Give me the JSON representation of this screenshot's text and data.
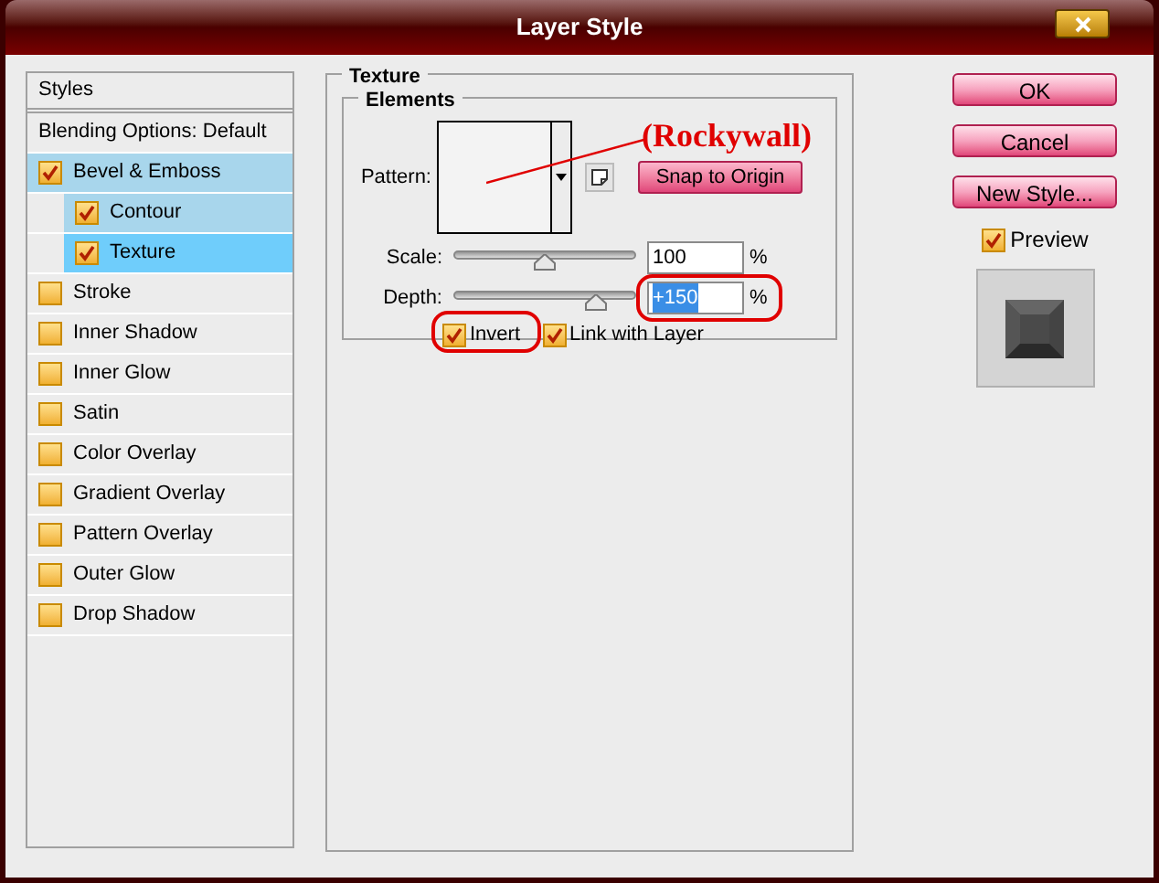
{
  "window": {
    "title": "Layer Style"
  },
  "sidebar": {
    "header": "Styles",
    "blending": "Blending Options: Default",
    "items": [
      {
        "label": "Bevel & Emboss",
        "checked": true,
        "selected": false,
        "expanded": true,
        "children": [
          {
            "label": "Contour",
            "checked": true,
            "selected": false
          },
          {
            "label": "Texture",
            "checked": true,
            "selected": true
          }
        ]
      },
      {
        "label": "Stroke",
        "checked": false,
        "selected": false
      },
      {
        "label": "Inner Shadow",
        "checked": false,
        "selected": false
      },
      {
        "label": "Inner Glow",
        "checked": false,
        "selected": false
      },
      {
        "label": "Satin",
        "checked": false,
        "selected": false
      },
      {
        "label": "Color Overlay",
        "checked": false,
        "selected": false
      },
      {
        "label": "Gradient Overlay",
        "checked": false,
        "selected": false
      },
      {
        "label": "Pattern Overlay",
        "checked": false,
        "selected": false
      },
      {
        "label": "Outer Glow",
        "checked": false,
        "selected": false
      },
      {
        "label": "Drop Shadow",
        "checked": false,
        "selected": false
      }
    ]
  },
  "texture": {
    "title": "Texture",
    "group": "Elements",
    "pattern_label": "Pattern:",
    "snap_button": "Snap to Origin",
    "sliders": [
      {
        "label": "Scale:",
        "level": 0.5,
        "value": "100",
        "unit": "%",
        "selected": false,
        "circled": false
      },
      {
        "label": "Depth:",
        "level": 0.78,
        "value": "+150",
        "unit": "%",
        "selected": true,
        "circled": true
      }
    ],
    "checkboxes": [
      {
        "label": "Invert",
        "checked": true,
        "circled": true
      },
      {
        "label": "Link with Layer",
        "checked": true,
        "circled": false
      }
    ],
    "annotation": "(Rockywall)"
  },
  "buttons": [
    "OK",
    "Cancel",
    "New Style..."
  ],
  "preview": {
    "label": "Preview",
    "checked": true
  }
}
